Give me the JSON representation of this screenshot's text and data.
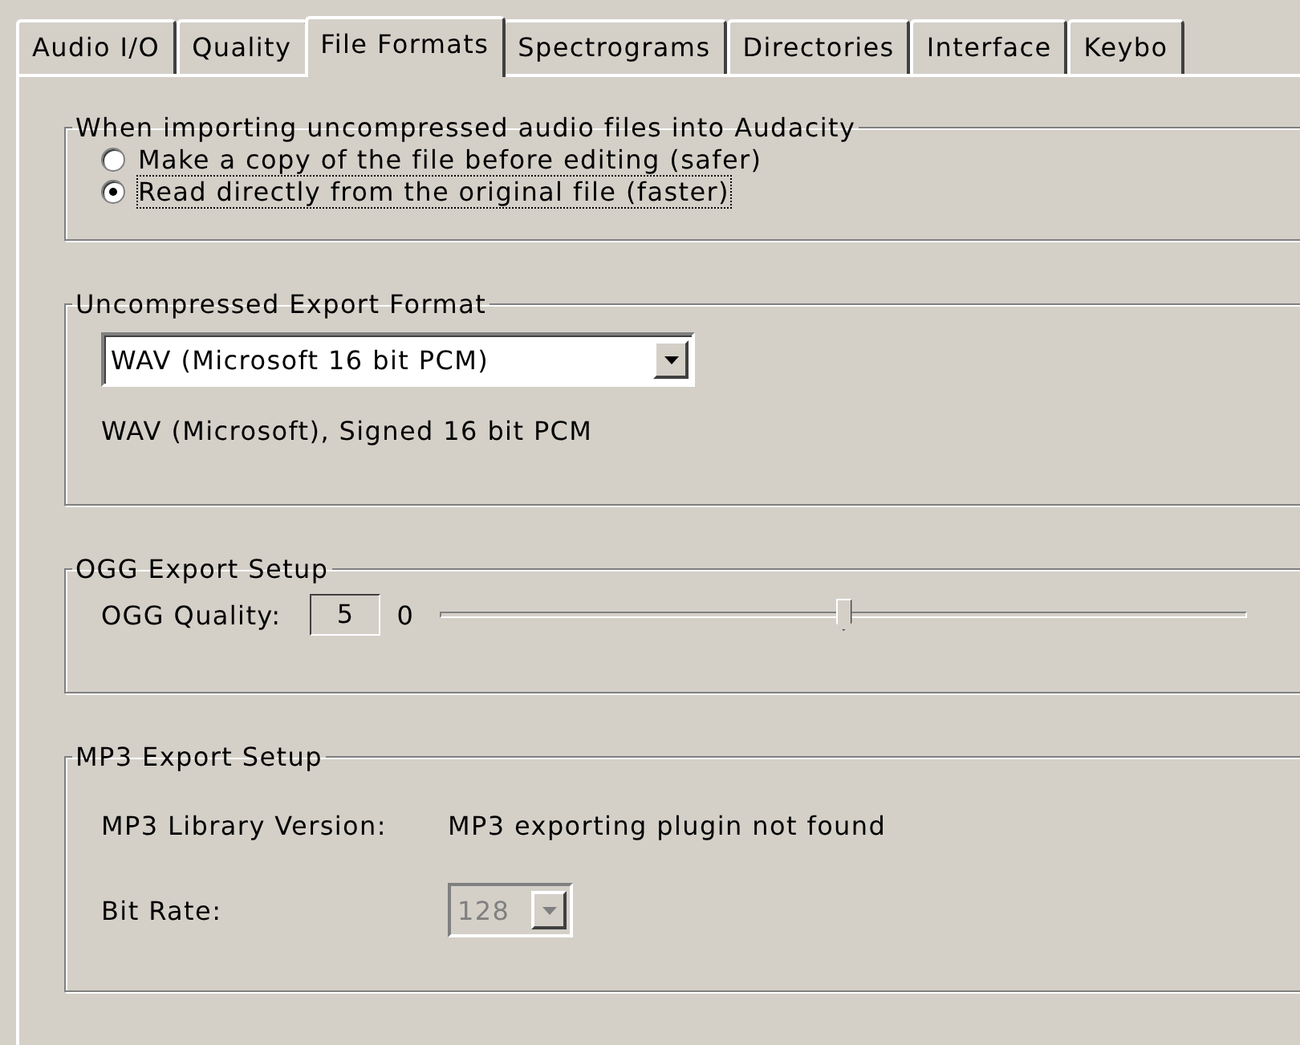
{
  "tabs": [
    {
      "label": "Audio I/O",
      "selected": false
    },
    {
      "label": "Quality",
      "selected": false
    },
    {
      "label": "File Formats",
      "selected": true
    },
    {
      "label": "Spectrograms",
      "selected": false
    },
    {
      "label": "Directories",
      "selected": false
    },
    {
      "label": "Interface",
      "selected": false
    },
    {
      "label": "Keybo",
      "selected": false
    }
  ],
  "import_group": {
    "title": "When importing uncompressed audio files into Audacity",
    "options": [
      {
        "label": "Make a copy of the file before editing (safer)",
        "selected": false
      },
      {
        "label": "Read directly from the original file (faster)",
        "selected": true
      }
    ]
  },
  "export_format_group": {
    "title": "Uncompressed Export Format",
    "dropdown": {
      "value": "WAV (Microsoft 16 bit PCM)"
    },
    "description": "WAV (Microsoft), Signed 16 bit PCM"
  },
  "ogg_group": {
    "title": "OGG Export Setup",
    "quality_label": "OGG Quality:",
    "quality_value": "5",
    "slider_min_label": "0",
    "slider": {
      "level": 0.5
    }
  },
  "mp3_group": {
    "title": "MP3 Export Setup",
    "library_label": "MP3 Library Version:",
    "library_value": "MP3 exporting plugin not found",
    "bitrate_label": "Bit Rate:",
    "bitrate": {
      "value": "128",
      "disabled": true
    }
  }
}
